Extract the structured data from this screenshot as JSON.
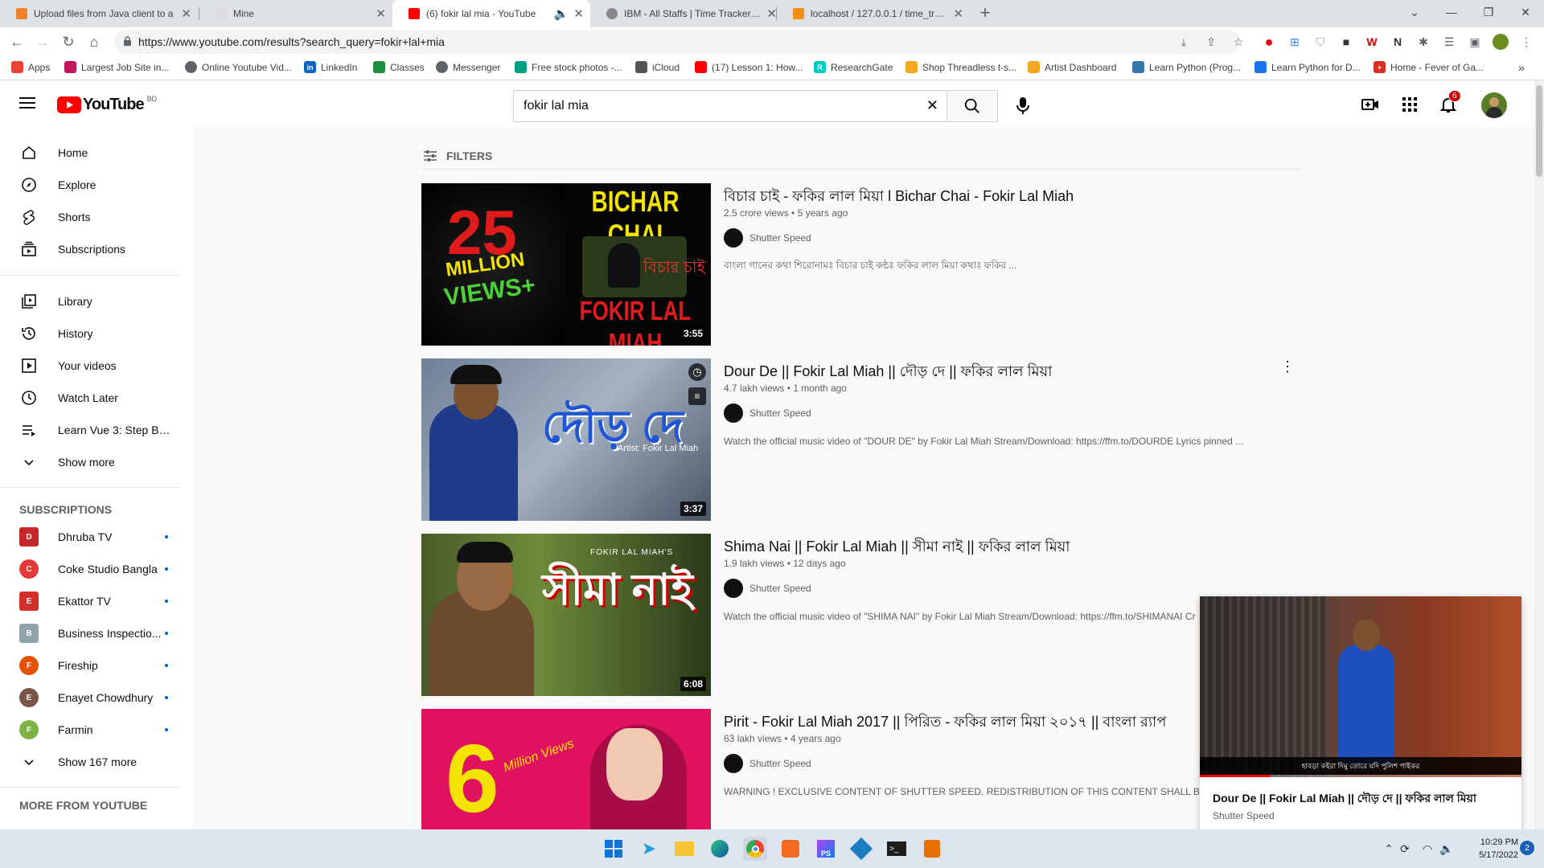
{
  "browser": {
    "tabs": [
      {
        "title": "Upload files from Java client to a",
        "active": false
      },
      {
        "title": "Mine",
        "active": false
      },
      {
        "title": "(6) fokir lal mia - YouTube",
        "active": true
      },
      {
        "title": "IBM - All Staffs | Time Tracker Sol",
        "active": false
      },
      {
        "title": "localhost / 127.0.0.1 / time_track",
        "active": false
      }
    ],
    "url": "https://www.youtube.com/results?search_query=fokir+lal+mia",
    "bookmarks": [
      {
        "label": "Apps",
        "icon": "apps-grid-icon",
        "color": "#ea4335"
      },
      {
        "label": "Largest Job Site in...",
        "icon": "job-site-icon",
        "color": "#c2185b"
      },
      {
        "label": "Online Youtube Vid...",
        "icon": "globe-icon",
        "color": "#5f6368"
      },
      {
        "label": "LinkedIn",
        "icon": "linkedin-icon",
        "color": "#0a66c2"
      },
      {
        "label": "Classes",
        "icon": "classroom-icon",
        "color": "#1e8e3e"
      },
      {
        "label": "Messenger",
        "icon": "globe-icon",
        "color": "#5f6368"
      },
      {
        "label": "Free stock photos -...",
        "icon": "photo-icon",
        "color": "#05a081"
      },
      {
        "label": "iCloud",
        "icon": "apple-icon",
        "color": "#555555"
      },
      {
        "label": "(17) Lesson 1: How...",
        "icon": "youtube-icon",
        "color": "#ff0000"
      },
      {
        "label": "ResearchGate",
        "icon": "researchgate-icon",
        "color": "#00ccbb"
      },
      {
        "label": "Shop Threadless t-s...",
        "icon": "pen-icon",
        "color": "#f5a623"
      },
      {
        "label": "Artist Dashboard",
        "icon": "pen-icon",
        "color": "#f5a623"
      },
      {
        "label": "Learn Python (Prog...",
        "icon": "python-icon",
        "color": "#3776ab"
      },
      {
        "label": "Learn Python for D...",
        "icon": "shield-icon",
        "color": "#1a73e8"
      },
      {
        "label": "Home - Fever of Ga...",
        "icon": "cross-icon",
        "color": "#d93025"
      }
    ]
  },
  "youtube": {
    "logo_text": "YouTube",
    "country": "BD",
    "search_value": "fokir lal mia",
    "notification_count": "6",
    "filters_label": "FILTERS",
    "sidebar": {
      "main": [
        {
          "label": "Home",
          "icon": "home-icon"
        },
        {
          "label": "Explore",
          "icon": "compass-icon"
        },
        {
          "label": "Shorts",
          "icon": "shorts-icon"
        },
        {
          "label": "Subscriptions",
          "icon": "subscriptions-icon"
        }
      ],
      "library": [
        {
          "label": "Library",
          "icon": "library-icon"
        },
        {
          "label": "History",
          "icon": "history-icon"
        },
        {
          "label": "Your videos",
          "icon": "your-videos-icon"
        },
        {
          "label": "Watch Later",
          "icon": "clock-icon"
        },
        {
          "label": "Learn Vue 3: Step By ...",
          "icon": "playlist-icon"
        },
        {
          "label": "Show more",
          "icon": "chevron-down-icon"
        }
      ],
      "subscriptions_heading": "SUBSCRIPTIONS",
      "subscriptions": [
        {
          "label": "Dhruba TV",
          "color": "#c62828",
          "initial": "D"
        },
        {
          "label": "Coke Studio Bangla",
          "color": "#e53935",
          "initial": "C"
        },
        {
          "label": "Ekattor TV",
          "color": "#d32f2f",
          "initial": "E"
        },
        {
          "label": "Business Inspectio...",
          "color": "#90a4ae",
          "initial": "B"
        },
        {
          "label": "Fireship",
          "color": "#e65100",
          "initial": "F"
        },
        {
          "label": "Enayet Chowdhury",
          "color": "#795548",
          "initial": "E"
        },
        {
          "label": "Farmin",
          "color": "#7cb342",
          "initial": "F"
        }
      ],
      "show_more_subs": "Show 167 more",
      "more_heading": "MORE FROM YOUTUBE"
    },
    "results": [
      {
        "title": "বিচার চাই - ফকির লাল মিয়া l Bichar Chai - Fokir Lal Miah",
        "views": "2.5 crore views",
        "age": "5 years ago",
        "channel": "Shutter Speed",
        "description": "বাংলা গানের কথা শিরোনামঃ বিচার চাই কন্ঠঃ ফকির লাল মিয়া কথাঃ ফকির ...",
        "duration": "3:55",
        "thumb_text": [
          "25",
          "MILLION",
          "VIEWS+",
          "BICHAR CHAI",
          "বিচার চাই",
          "FOKIR LAL MIAH"
        ]
      },
      {
        "title": "Dour De || Fokir Lal Miah || দৌড় দে || ফকির লাল মিয়া",
        "views": "4.7 lakh views",
        "age": "1 month ago",
        "channel": "Shutter Speed",
        "description": "Watch the official music video of \"DOUR DE\" by Fokir Lal Miah Stream/Download: https://ffm.to/DOURDE Lyrics pinned ...",
        "duration": "3:37",
        "thumb_text": [
          "দৌড় দে",
          "Artist: Fokir Lal Miah"
        ]
      },
      {
        "title": "Shima Nai || Fokir Lal Miah || সীমা নাই || ফকির লাল মিয়া",
        "views": "1.9 lakh views",
        "age": "12 days ago",
        "channel": "Shutter Speed",
        "description": "Watch the official music video of \"SHIMA NAI\" by Fokir Lal Miah Stream/Download: https://ffm.to/SHIMANAI Cr",
        "duration": "6:08",
        "thumb_text": [
          "FOKIR LAL MIAH'S",
          "সীমা নাই"
        ]
      },
      {
        "title": "Pirit - Fokir Lal Miah 2017 || পিরিত - ফকির লাল মিয়া ২০১৭ || বাংলা র‍্যাপ",
        "views": "63 lakh views",
        "age": "4 years ago",
        "channel": "Shutter Speed",
        "description": "WARNING ! EXCLUSIVE CONTENT OF SHUTTER SPEED. REDISTRIBUTION OF THIS CONTENT SHALL BE DEEME",
        "duration": "",
        "thumb_text": [
          "6",
          "Million Views"
        ]
      }
    ],
    "miniplayer": {
      "title": "Dour De || Fokir Lal Miah || দৌড় দে || ফকির লাল মিয়া",
      "channel": "Shutter Speed",
      "subtitle": "হাবড়া কইরা দিমু তোরে যদি পুলিশ পাইকর",
      "progress": 0.22
    }
  },
  "taskbar": {
    "time": "10:29 PM",
    "date": "5/17/2022",
    "notification_badge": "2"
  }
}
